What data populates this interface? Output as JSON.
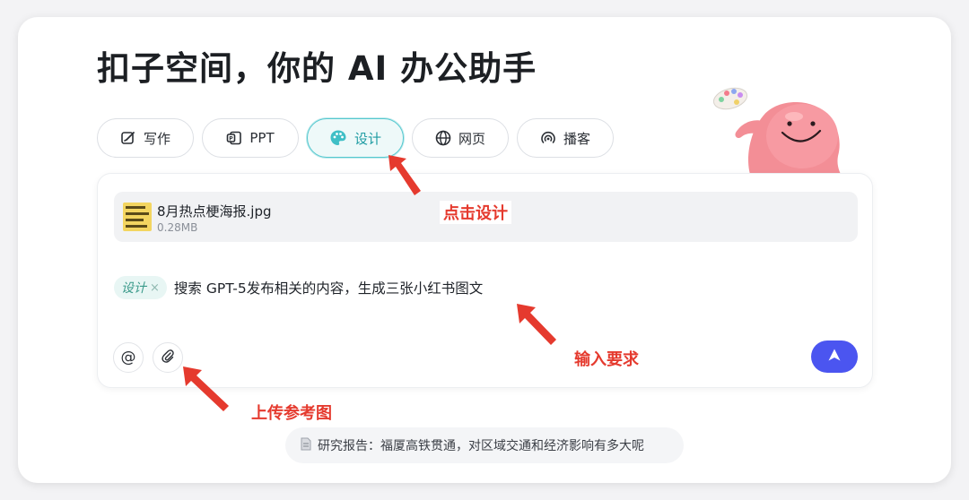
{
  "header": {
    "title": "扣子空间，你的 AI 办公助手"
  },
  "tabs": [
    {
      "label": "写作",
      "icon": "pen-square-icon"
    },
    {
      "label": "PPT",
      "icon": "ppt-icon"
    },
    {
      "label": "设计",
      "icon": "palette-icon",
      "active": true
    },
    {
      "label": "网页",
      "icon": "globe-icon"
    },
    {
      "label": "播客",
      "icon": "podcast-icon"
    }
  ],
  "attachment": {
    "name": "8月热点梗海报.jpg",
    "size": "0.28MB"
  },
  "prompt": {
    "tag": "设计",
    "tag_close": "×",
    "text": "搜索 GPT-5发布相关的内容，生成三张小红书图文"
  },
  "toolbar": {
    "mention_symbol": "@",
    "attach_icon": "paperclip-icon",
    "send_icon": "send-arrow-icon"
  },
  "annotations": {
    "click_design": "点击设计",
    "input_requirement": "输入要求",
    "upload_reference": "上传参考图"
  },
  "suggestion": {
    "text": "研究报告：福厦高铁贯通，对区域交通和经济影响有多大呢",
    "icon": "document-icon"
  },
  "colors": {
    "accent_teal": "#3fbfc6",
    "send_button": "#4b55f0",
    "annotation_red": "#e53a2e"
  }
}
